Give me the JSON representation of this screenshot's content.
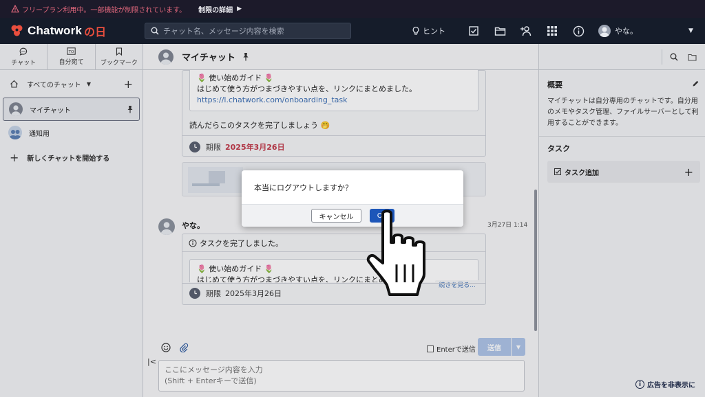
{
  "warning_bar": {
    "message": "フリープラン利用中。一部機能が制限されています。",
    "detail_link": "制限の詳細"
  },
  "header": {
    "logo_text": "Chatwork",
    "logo_sub": "の日",
    "search_placeholder": "チャット名、メッセージ内容を検索",
    "hint_label": "ヒント",
    "user_name": "やな。"
  },
  "left_sidebar": {
    "tabs": [
      {
        "label": "チャット"
      },
      {
        "label": "自分宛て"
      },
      {
        "label": "ブックマーク"
      }
    ],
    "filter_label": "すべてのチャット",
    "rooms": [
      {
        "name": "マイチャット"
      },
      {
        "name": "通知用"
      }
    ],
    "new_chat_label": "新しくチャットを開始する"
  },
  "main": {
    "room_title": "マイチャット",
    "message1": {
      "guide_title": "🌷 使い始めガイド 🌷",
      "guide_body": "はじめて使う方がつまづきやすい点を、リンクにまとめました。",
      "guide_link": "https://l.chatwork.com/onboarding_task",
      "follow_text": "読んだらこのタスクを完了しましょう 🤭",
      "deadline_label": "期限",
      "deadline_date": "2025年3月26日"
    },
    "message2": {
      "sender": "やな。",
      "time": "3月27日 1:14",
      "task_done": "タスクを完了しました。",
      "guide_title": "🌷 使い始めガイド 🌷",
      "guide_body": "はじめて使う方がつまづきやすい点を、リンクにまとめました。",
      "read_more": "続きを見る...",
      "deadline_label": "期限",
      "deadline_date": "2025年3月26日"
    },
    "composer": {
      "enter_send_label": "Enterで送信",
      "send_label": "送信",
      "placeholder": "ここにメッセージ内容を入力\n(Shift + Enterキーで送信)"
    }
  },
  "right_panel": {
    "overview_title": "概要",
    "overview_desc": "マイチャットは自分専用のチャットです。自分用のメモやタスク管理、ファイルサーバーとして利用することができます。",
    "task_title": "タスク",
    "task_add_label": "タスク追加",
    "ad_hide_label": "広告を非表示に"
  },
  "dialog": {
    "message": "本当にログアウトしますか？",
    "cancel_label": "キャンセル",
    "ok_label": "OK"
  },
  "colors": {
    "brand_red": "#e84e3e",
    "accent_blue": "#1d56b9",
    "deadline_red": "#c23b4b",
    "header_bg": "#151c2a"
  }
}
